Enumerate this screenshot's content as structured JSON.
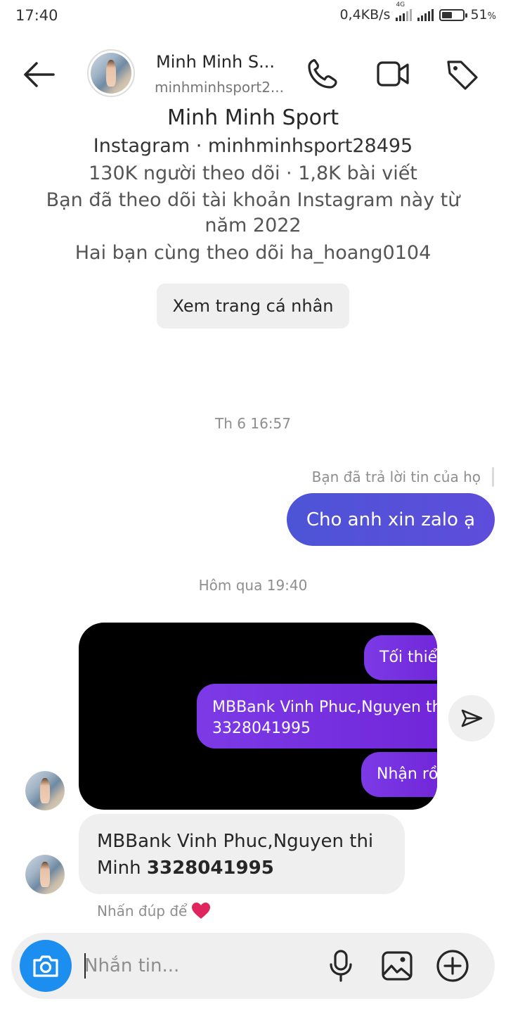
{
  "status_bar": {
    "time": "17:40",
    "network_speed": "0,4KB/s",
    "network_type": "4G",
    "battery_percent": "51",
    "battery_level": 0.51,
    "battery_suffix": "%"
  },
  "header": {
    "display_name": "Minh Minh S...",
    "username": "minhminhsport2...",
    "icons": [
      "back-arrow-icon",
      "phone-icon",
      "video-camera-icon",
      "tag-icon"
    ]
  },
  "profile": {
    "name": "Minh Minh Sport",
    "platform_line": "Instagram · minhminhsport28495",
    "stats_line": "130K người theo dõi · 1,8K bài viết",
    "follow_since_line1": "Bạn đã theo dõi tài khoản Instagram này từ",
    "follow_since_line2": "năm 2022",
    "mutual_line": "Hai bạn cùng theo dõi ha_hoang0104",
    "view_profile_label": "Xem trang cá nhân"
  },
  "thread": {
    "timestamp_1": "Th 6 16:57",
    "reply_note": "Bạn đã trả lời tin của họ",
    "outgoing_message": "Cho anh xin zalo ạ",
    "timestamp_2": "Hôm qua 19:40",
    "shared_image": {
      "bubble_1": "Tối thiểu",
      "bubble_2_line1": "MBBank Vinh Phuc,Nguyen thi",
      "bubble_2_line2": "3328041995",
      "bubble_3": "Nhận rồi"
    },
    "incoming_message_text": "MBBank Vinh Phuc,Nguyen thi Minh ",
    "incoming_message_account": "3328041995",
    "double_tap_hint": "Nhấn đúp để",
    "heart_color": "#e0245e",
    "accent_color": "#5851db"
  },
  "composer": {
    "placeholder": "Nhắn tin...",
    "icons": [
      "camera-icon",
      "microphone-icon",
      "gallery-icon",
      "add-icon"
    ]
  }
}
